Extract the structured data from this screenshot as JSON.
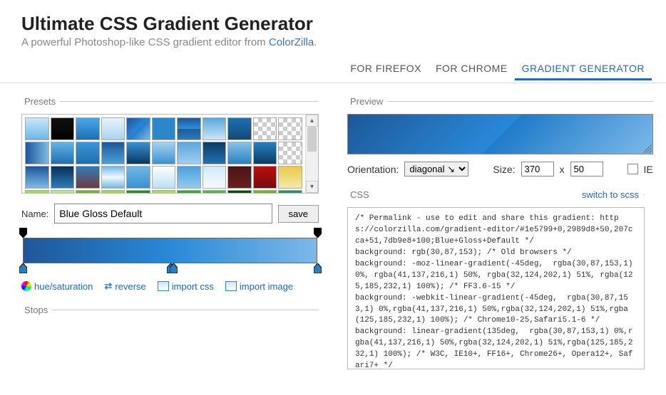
{
  "header": {
    "title": "Ultimate CSS Gradient Generator",
    "subtitle_pre": "A powerful Photoshop-like CSS gradient editor from ",
    "subtitle_link": "ColorZilla",
    "subtitle_post": "."
  },
  "tabs": {
    "items": [
      "FOR FIREFOX",
      "FOR CHROME",
      "GRADIENT GENERATOR"
    ],
    "active": 2
  },
  "presets": {
    "legend": "Presets",
    "name_label": "Name:",
    "name_value": "Blue Gloss Default",
    "save_label": "save",
    "swatches": [
      "linear-gradient(#c9e6f7,#6db7e8)",
      "linear-gradient(#111,#000)",
      "linear-gradient(#49a7e9,#1b6fb5)",
      "linear-gradient(#e8f4fb,#a8d4ef)",
      "linear-gradient(135deg,#1e5799 0%,#2989d8 50%,#207cca 51%,#7db9e8 100%)",
      "linear-gradient(#2a87c9,#2a87c9)",
      "linear-gradient(#1e5799,#2e8fd6 50%,#1d5e9a 51%,#2a77b8)",
      "linear-gradient(#5aa7dd,#cbe6f6)",
      "linear-gradient(#1f6fb3,#134a78)",
      "checker-a",
      "checker-b",
      "linear-gradient(90deg,#1e5799,#7db9e8)",
      "linear-gradient(#64b3e6,#1e6fb0)",
      "linear-gradient(#3a95d6,#1f70b0)",
      "linear-gradient(#1e5799,#4aa0db)",
      "linear-gradient(#3a91d1,#06395f)",
      "linear-gradient(#a7d3f0,#3a91d1)",
      "linear-gradient(#5aa7dd,#9ecef0)",
      "linear-gradient(#093b63,#2171b1)",
      "linear-gradient(#87c3ea,#2a7fc0)",
      "linear-gradient(#2a7fc0,#0a3b62)",
      "checker-c",
      "linear-gradient(#1e5799,#7db9e8)",
      "linear-gradient(#063157,#2e7cb8)",
      "linear-gradient(#2e7cb8,#6f3b41)",
      "linear-gradient(#6fb8e6,#f1f8fc 50%,#6fb8e6)",
      "linear-gradient(#6fb8e6,#3a91d1)",
      "linear-gradient(#fff,#bde0f6)",
      "linear-gradient(#4aa0db,#93cbef)",
      "linear-gradient(#d0e9f9,#f6fbfe)",
      "linear-gradient(#4a1414,#6b1f1f)",
      "linear-gradient(#b71010,#7a0b0b)",
      "linear-gradient(#e8c94b,#f5e9a6)",
      "linear-gradient(#a4d867,#7ab33b)",
      "linear-gradient(#c3e49b,#8cc34b)",
      "linear-gradient(#7ab33b,#4f7a1f)",
      "linear-gradient(#9bd45a,#bfe68f)",
      "linear-gradient(#2f8a2f,#1a5a1a)",
      "linear-gradient(#a4d867,#c8e8a1)",
      "linear-gradient(#3fa33f,#2f8a2f)",
      "linear-gradient(#5fb35f,#0a4a0a)",
      "linear-gradient(#0a4a0a,#2f8a2f)",
      "linear-gradient(#7ab33b,#0a4a0a)",
      "linear-gradient(#2f8a5f,#6fc49b)"
    ]
  },
  "slider": {
    "top_handles": [
      0,
      100
    ],
    "bottom_handles": [
      0,
      50,
      51,
      100
    ]
  },
  "actions": {
    "hue": "hue/saturation",
    "reverse": "reverse",
    "import_css": "import css",
    "import_image": "import image"
  },
  "stops": {
    "legend": "Stops"
  },
  "preview": {
    "legend": "Preview",
    "orientation_label": "Orientation:",
    "orientation_value": "diagonal ↘",
    "size_label": "Size:",
    "width": "370",
    "height": "50",
    "x": "x",
    "ie_label": "IE"
  },
  "css": {
    "legend": "CSS",
    "switch": "switch to scss",
    "code": "/* Permalink - use to edit and share this gradient: https://colorzilla.com/gradient-editor/#1e5799+0,2989d8+50,207cca+51,7db9e8+100;Blue+Gloss+Default */\nbackground: rgb(30,87,153); /* Old browsers */\nbackground: -moz-linear-gradient(-45deg,  rgba(30,87,153,1) 0%, rgba(41,137,216,1) 50%, rgba(32,124,202,1) 51%, rgba(125,185,232,1) 100%); /* FF3.6-15 */\nbackground: -webkit-linear-gradient(-45deg,  rgba(30,87,153,1) 0%,rgba(41,137,216,1) 50%,rgba(32,124,202,1) 51%,rgba(125,185,232,1) 100%); /* Chrome10-25,Safari5.1-6 */\nbackground: linear-gradient(135deg,  rgba(30,87,153,1) 0%,rgba(41,137,216,1) 50%,rgba(32,124,202,1) 51%,rgba(125,185,232,1) 100%); /* W3C, IE10+, FF16+, Chrome26+, Opera12+, Safari7+ */\nfilter: progid:DXImageTransform.Microsoft.gradient("
  }
}
